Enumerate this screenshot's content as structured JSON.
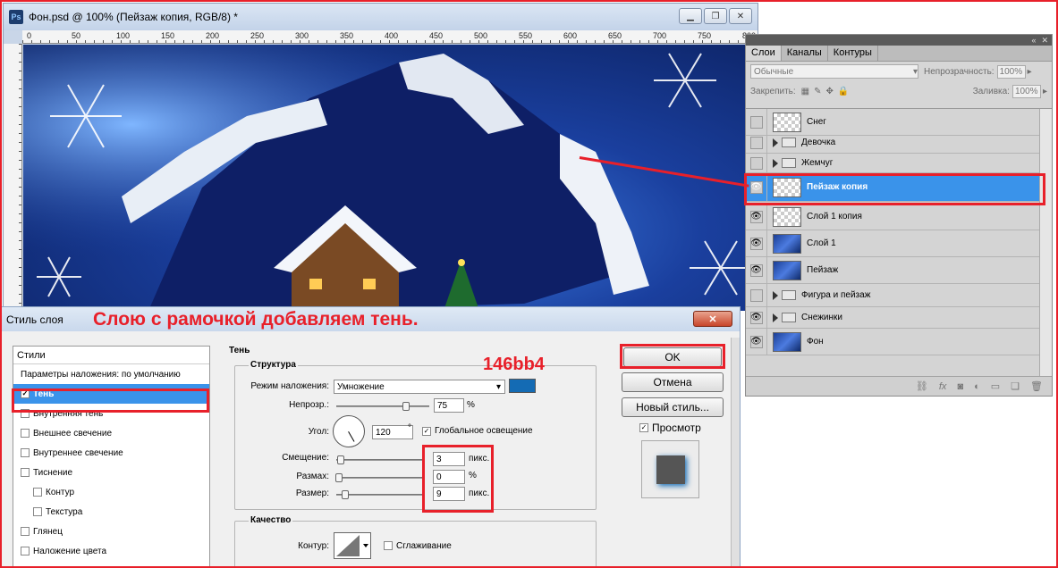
{
  "document": {
    "title": "Фон.psd @ 100% (Пейзаж копия, RGB/8) *",
    "app_icon": "Ps",
    "ruler_marks": [
      "0",
      "50",
      "100",
      "150",
      "200",
      "250",
      "300",
      "350",
      "400",
      "450",
      "500",
      "550",
      "600",
      "650",
      "700",
      "750",
      "800"
    ],
    "ruler_left_marks": [
      "5",
      "0",
      "1",
      "0",
      "0",
      "1",
      "5",
      "0",
      "2",
      "0",
      "0",
      "2",
      "5",
      "0"
    ]
  },
  "annotations": {
    "headline": "Слою с рамочкой добавляем тень.",
    "color_code": "146bb4"
  },
  "layers_panel": {
    "tabs": [
      "Слои",
      "Каналы",
      "Контуры"
    ],
    "blend_mode": "Обычные",
    "opacity_label": "Непрозрачность:",
    "opacity_value": "100%",
    "lock_label": "Закрепить:",
    "fill_label": "Заливка:",
    "fill_value": "100%",
    "layers": [
      {
        "name": "Снег",
        "type": "layer",
        "visible": false,
        "thumb": "transparent"
      },
      {
        "name": "Девочка",
        "type": "group",
        "visible": false
      },
      {
        "name": "Жемчуг",
        "type": "group",
        "visible": false
      },
      {
        "name": "Пейзаж копия",
        "type": "layer",
        "visible": true,
        "thumb": "transparent",
        "selected": true
      },
      {
        "name": "Слой 1 копия",
        "type": "layer",
        "visible": true,
        "thumb": "transparent"
      },
      {
        "name": "Слой 1",
        "type": "layer",
        "visible": true,
        "thumb": "image"
      },
      {
        "name": "Пейзаж",
        "type": "layer",
        "visible": true,
        "thumb": "image"
      },
      {
        "name": "Фигура и пейзаж",
        "type": "group",
        "visible": false
      },
      {
        "name": "Снежинки",
        "type": "group",
        "visible": true
      },
      {
        "name": "Фон",
        "type": "layer",
        "visible": true,
        "thumb": "image"
      }
    ],
    "bottom_icons": [
      "link-icon",
      "fx-icon",
      "mask-icon",
      "adjustment-icon",
      "group-icon",
      "new-layer-icon",
      "trash-icon"
    ]
  },
  "dialog": {
    "title": "Стиль слоя",
    "close": "✕",
    "styles_header": "Стили",
    "blend_options": "Параметры наложения: по умолчанию",
    "styles": [
      {
        "label": "Тень",
        "checked": true,
        "active": true
      },
      {
        "label": "Внутренняя тень",
        "checked": false
      },
      {
        "label": "Внешнее свечение",
        "checked": false
      },
      {
        "label": "Внутреннее свечение",
        "checked": false
      },
      {
        "label": "Тиснение",
        "checked": false
      },
      {
        "label": "Контур",
        "checked": false,
        "sub": true
      },
      {
        "label": "Текстура",
        "checked": false,
        "sub": true
      },
      {
        "label": "Глянец",
        "checked": false
      },
      {
        "label": "Наложение цвета",
        "checked": false
      }
    ],
    "section_title": "Тень",
    "structure_title": "Структура",
    "blend_mode_label": "Режим наложения:",
    "blend_mode_value": "Умножение",
    "blend_color": "#146bb4",
    "opacity_label": "Непрозр.:",
    "opacity_value": "75",
    "opacity_unit": "%",
    "angle_label": "Угол:",
    "angle_value": "120",
    "angle_unit": "°",
    "global_light": "Глобальное освещение",
    "distance_label": "Смещение:",
    "distance_value": "3",
    "distance_unit": "пикс.",
    "spread_label": "Размах:",
    "spread_value": "0",
    "spread_unit": "%",
    "size_label": "Размер:",
    "size_value": "9",
    "size_unit": "пикс.",
    "quality_title": "Качество",
    "contour_label": "Контур:",
    "antialias_label": "Сглаживание",
    "ok": "OK",
    "cancel": "Отмена",
    "new_style": "Новый стиль...",
    "preview": "Просмотр"
  }
}
